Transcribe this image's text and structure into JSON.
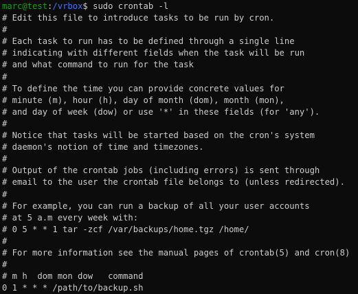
{
  "prompt": {
    "user_host": "marc@test",
    "colon": ":",
    "path": "/vrbox",
    "symbol": "$ ",
    "command": "sudo crontab -l"
  },
  "output_lines": [
    "# Edit this file to introduce tasks to be run by cron.",
    "#",
    "# Each task to run has to be defined through a single line",
    "# indicating with different fields when the task will be run",
    "# and what command to run for the task",
    "#",
    "# To define the time you can provide concrete values for",
    "# minute (m), hour (h), day of month (dom), month (mon),",
    "# and day of week (dow) or use '*' in these fields (for 'any').",
    "#",
    "# Notice that tasks will be started based on the cron's system",
    "# daemon's notion of time and timezones.",
    "#",
    "# Output of the crontab jobs (including errors) is sent through",
    "# email to the user the crontab file belongs to (unless redirected).",
    "#",
    "# For example, you can run a backup of all your user accounts",
    "# at 5 a.m every week with:",
    "# 0 5 * * 1 tar -zcf /var/backups/home.tgz /home/",
    "#",
    "# For more information see the manual pages of crontab(5) and cron(8)",
    "#",
    "# m h  dom mon dow   command",
    "0 1 * * * /path/to/backup.sh"
  ],
  "colors": {
    "background": "#0c0c0c",
    "text": "#cccccc",
    "user_host": "#13a10e",
    "path": "#3b78ff"
  }
}
